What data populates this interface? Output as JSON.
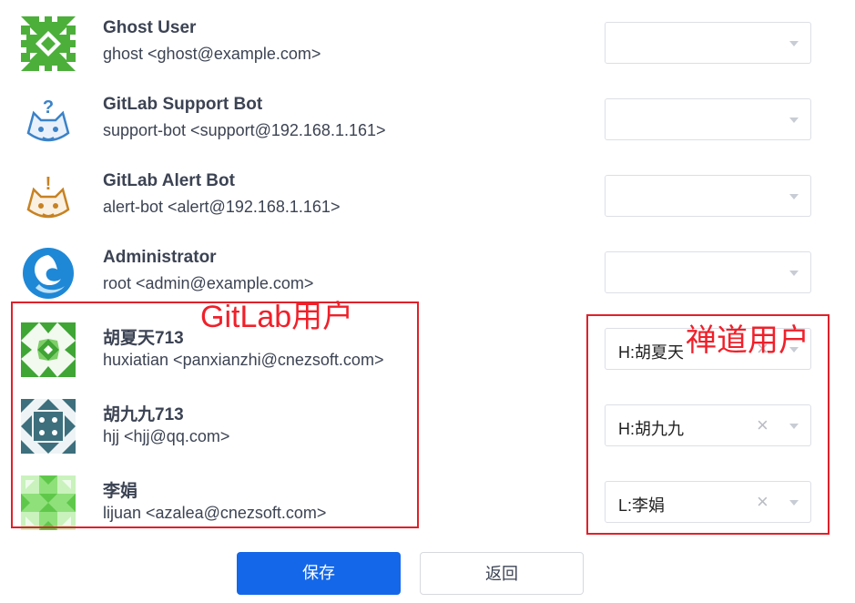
{
  "users": [
    {
      "name": "Ghost User",
      "email": "ghost <ghost@example.com>",
      "avatar": "identicon-green",
      "mapped": "",
      "has_clear": false
    },
    {
      "name": "GitLab Support Bot",
      "email": "support-bot <support@192.168.1.161>",
      "avatar": "support-bot-icon",
      "mapped": "",
      "has_clear": false
    },
    {
      "name": "GitLab Alert Bot",
      "email": "alert-bot <alert@192.168.1.161>",
      "avatar": "alert-bot-icon",
      "mapped": "",
      "has_clear": false
    },
    {
      "name": "Administrator",
      "email": "root <admin@example.com>",
      "avatar": "admin-logo-icon",
      "mapped": "",
      "has_clear": false
    },
    {
      "name": "胡夏天713",
      "email": "huxiatian <panxianzhi@cnezsoft.com>",
      "avatar": "identicon-green-triangles",
      "mapped": "H:胡夏天",
      "has_clear": true
    },
    {
      "name": "胡九九713",
      "email": "hjj <hjj@qq.com>",
      "avatar": "identicon-teal",
      "mapped": "H:胡九九",
      "has_clear": true
    },
    {
      "name": "李娟",
      "email": "lijuan <azalea@cnezsoft.com>",
      "avatar": "identicon-lime",
      "mapped": "L:李娟",
      "has_clear": true
    }
  ],
  "annotations": {
    "gitlab_label": "GitLab用户",
    "zentao_label": "禅道用户"
  },
  "buttons": {
    "save": "保存",
    "back": "返回"
  },
  "icons": {
    "clear": "×"
  },
  "colors": {
    "primary": "#1467e8",
    "annotation": "#e0202a"
  }
}
